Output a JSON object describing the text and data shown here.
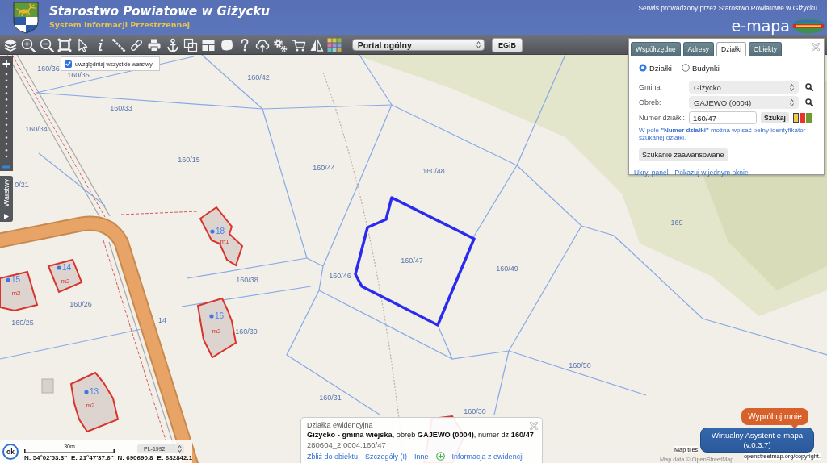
{
  "header": {
    "title": "Starostwo Powiatowe w Giżycku",
    "subtitle": "System Informacji Przestrzennej",
    "operator_note": "Serwis prowadzony przez Starostwo Powiatowe w Giżycku",
    "brand": "e-mapa"
  },
  "toolbar": {
    "portal_select": {
      "value": "Portal ogólny"
    },
    "egib_button": {
      "label": "EGiB"
    }
  },
  "layer_option": {
    "label": "uwzględniaj wszystkie warstwy",
    "checked": true
  },
  "side_tab": {
    "label": "Warstwy"
  },
  "search_panel": {
    "tabs": [
      {
        "label": "Współrzędne",
        "selected": false
      },
      {
        "label": "Adresy",
        "selected": false
      },
      {
        "label": "Działki",
        "selected": true
      },
      {
        "label": "Obiekty",
        "selected": false
      }
    ],
    "object_types": [
      {
        "label": "Działki",
        "selected": true
      },
      {
        "label": "Budynki",
        "selected": false
      }
    ],
    "fields": [
      {
        "label": "Gmina:",
        "value": "Giżycko",
        "kind": "select"
      },
      {
        "label": "Obręb:",
        "value": "GAJEWO (0004)",
        "kind": "select"
      },
      {
        "label": "Numer działki:",
        "value": "160/47",
        "kind": "input"
      }
    ],
    "search_button": {
      "label": "Szukaj"
    },
    "highlight_colors": [
      {
        "color": "#f2c94c",
        "selected": true
      },
      {
        "color": "#e8322b",
        "selected": false
      },
      {
        "color": "#6f9a2e",
        "selected": false
      }
    ],
    "hint": "W pole **\"Numer działki\"** można wpisać pełny identyfikator szukanej działki.",
    "advanced_button": {
      "label": "Szukanie zaawansowane"
    },
    "links": [
      {
        "label": "Ukryj panel"
      },
      {
        "label": "Pokazuj w jednym oknie"
      }
    ]
  },
  "map": {
    "parcel_labels": [
      "160/36",
      "160/35",
      "160/42",
      "160/33",
      "160/34",
      "160/15",
      "0/21",
      "160/44",
      "160/48",
      "169",
      "160/47",
      "160/49",
      "160/46",
      "160/38",
      "160/26",
      "160/25",
      "14",
      "160/39",
      "160/50",
      "160/31",
      "160/30"
    ],
    "buildings": [
      {
        "number": "18",
        "type": "m1"
      },
      {
        "number": "14",
        "type": "m2"
      },
      {
        "number": "15",
        "type": "m2"
      },
      {
        "number": "16",
        "type": "m2"
      },
      {
        "number": "13",
        "type": "m2"
      }
    ]
  },
  "info_popup": {
    "heading": "Działka ewidencyjna",
    "description": "**Giżycko - gmina wiejska**, obręb **GAJEWO (0004)**, numer dz.**160/47**",
    "identifier": "280604_2.0004.160/47",
    "actions": [
      {
        "label": "Zbliż do obiektu",
        "kind": "link"
      },
      {
        "label": "Szczegóły (I)",
        "kind": "link"
      },
      {
        "label": "Inne",
        "kind": "link"
      },
      {
        "label": "Informacja z ewidencji",
        "kind": "icon_link"
      }
    ]
  },
  "status": {
    "ok_button": "ok",
    "scale_label": "30m",
    "crs_select": "PL-1992",
    "coordinates": [
      "N: 54°02′53.3″",
      "E: 21°47′37.6″",
      "N: 690690.8",
      "E: 682842.1"
    ]
  },
  "assistant": {
    "prompt": "Wypróbuj mnie",
    "button_label": "Wirtualny Asystent e-mapa",
    "version": "(v.0.3.7)"
  },
  "attribution": [
    "Map tiles",
    "Map data © OpenStreetMap",
    "openstreetmap.org/copyright."
  ]
}
